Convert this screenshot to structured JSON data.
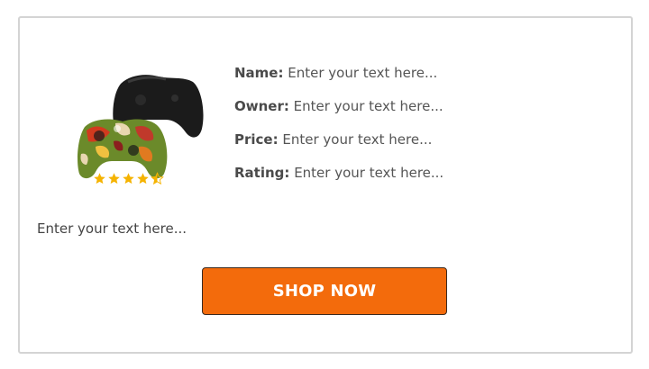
{
  "product": {
    "image_icon": "game-controller-image",
    "rating_stars": 4.5,
    "rating_max": 5,
    "star_color": "#f5b301"
  },
  "info": {
    "name_label": "Name:",
    "name_value": "Enter your text here...",
    "owner_label": "Owner:",
    "owner_value": "Enter your text here...",
    "price_label": "Price:",
    "price_value": "Enter your text here...",
    "rating_label": "Rating:",
    "rating_value": "Enter your text here..."
  },
  "description": "Enter your text here...",
  "button": {
    "label": "SHOP NOW",
    "color": "#f36b0c"
  }
}
